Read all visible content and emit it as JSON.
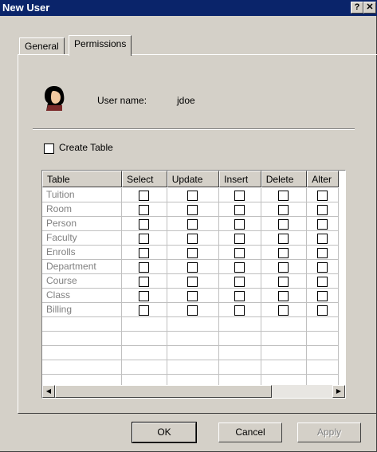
{
  "window": {
    "title": "New User",
    "help_label": "?",
    "close_label": "✕"
  },
  "tabs": [
    {
      "label": "General",
      "active": false
    },
    {
      "label": "Permissions",
      "active": true
    }
  ],
  "user": {
    "label": "User name:",
    "value": "jdoe"
  },
  "create_table": {
    "label": "Create Table",
    "checked": false
  },
  "grid": {
    "columns": [
      "Table",
      "Select",
      "Update",
      "Insert",
      "Delete",
      "Alter"
    ],
    "rows": [
      {
        "name": "Tuition"
      },
      {
        "name": "Room"
      },
      {
        "name": "Person"
      },
      {
        "name": "Faculty"
      },
      {
        "name": "Enrolls"
      },
      {
        "name": "Department"
      },
      {
        "name": "Course"
      },
      {
        "name": "Class"
      },
      {
        "name": "Billing"
      }
    ],
    "empty_rows": 5
  },
  "buttons": {
    "ok": "OK",
    "cancel": "Cancel",
    "apply": "Apply"
  },
  "colors": {
    "titlebar": "#0a246a",
    "face": "#d4d0c8"
  }
}
